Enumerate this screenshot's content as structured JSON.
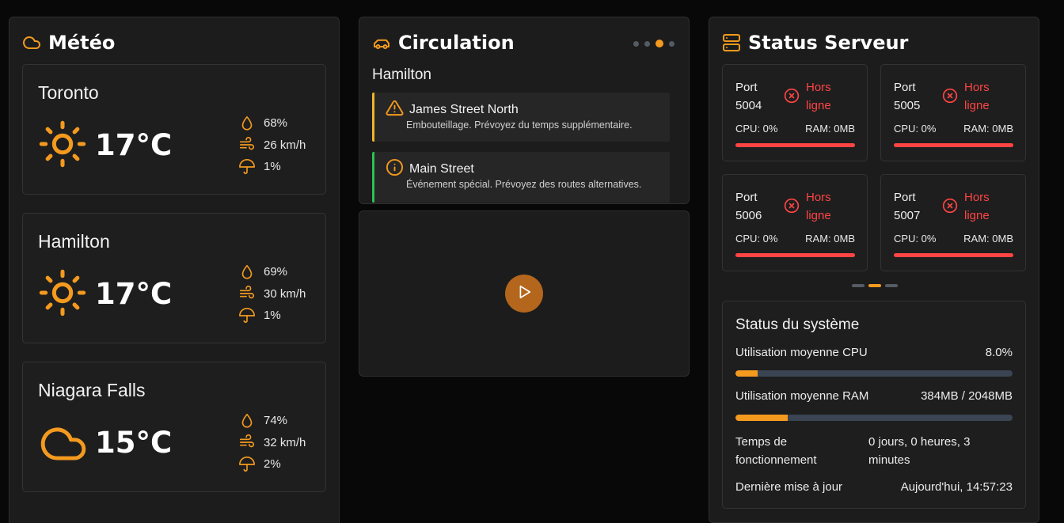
{
  "weather": {
    "title": "Météo",
    "title_icon": "cloud-icon",
    "accent": "#f39a1f",
    "cities": [
      {
        "name": "Toronto",
        "icon": "sun-icon",
        "temp": "17°C",
        "humidity": "68%",
        "wind": "26 km/h",
        "precip": "1%"
      },
      {
        "name": "Hamilton",
        "icon": "sun-icon",
        "temp": "17°C",
        "humidity": "69%",
        "wind": "30 km/h",
        "precip": "1%"
      },
      {
        "name": "Niagara Falls",
        "icon": "cloud-icon",
        "temp": "15°C",
        "humidity": "74%",
        "wind": "32 km/h",
        "precip": "2%"
      }
    ]
  },
  "traffic": {
    "title": "Circulation",
    "title_icon": "car-icon",
    "city": "Hamilton",
    "carousel_dots": 4,
    "active_dot": 3,
    "alerts": [
      {
        "type": "warning",
        "icon": "warning-icon",
        "color": "#f0b429",
        "title": "James Street North",
        "description": "Embouteillage. Prévoyez du temps supplémentaire."
      },
      {
        "type": "info",
        "icon": "info-icon",
        "color": "#2fbf55",
        "title": "Main Street",
        "description": "Événement spécial. Prévoyez des routes alternatives."
      }
    ],
    "video": {
      "icon": "play-icon"
    }
  },
  "servers": {
    "title": "Status Serveur",
    "title_icon": "server-icon",
    "offline_color": "#ff4444",
    "items": [
      {
        "port_label": "Port",
        "port": "5004",
        "status_1": "Hors",
        "status_2": "ligne",
        "cpu": "CPU: 0%",
        "ram": "RAM: 0MB"
      },
      {
        "port_label": "Port",
        "port": "5005",
        "status_1": "Hors",
        "status_2": "ligne",
        "cpu": "CPU: 0%",
        "ram": "RAM: 0MB"
      },
      {
        "port_label": "Port",
        "port": "5006",
        "status_1": "Hors",
        "status_2": "ligne",
        "cpu": "CPU: 0%",
        "ram": "RAM: 0MB"
      },
      {
        "port_label": "Port",
        "port": "5007",
        "status_1": "Hors",
        "status_2": "ligne",
        "cpu": "CPU: 0%",
        "ram": "RAM: 0MB"
      }
    ],
    "pager_count": 3,
    "pager_active": 2
  },
  "system": {
    "title": "Status du système",
    "cpu_label": "Utilisation moyenne CPU",
    "cpu_value": "8.0%",
    "cpu_fraction": 0.08,
    "ram_label": "Utilisation moyenne RAM",
    "ram_value": "384MB / 2048MB",
    "ram_fraction": 0.1875,
    "uptime_label_1": "Temps de",
    "uptime_label_2": "fonctionnement",
    "uptime_value_1": "0 jours, 0 heures, 3",
    "uptime_value_2": "minutes",
    "updated_label": "Dernière mise à jour",
    "updated_value": "Aujourd'hui, 14:57:23"
  }
}
